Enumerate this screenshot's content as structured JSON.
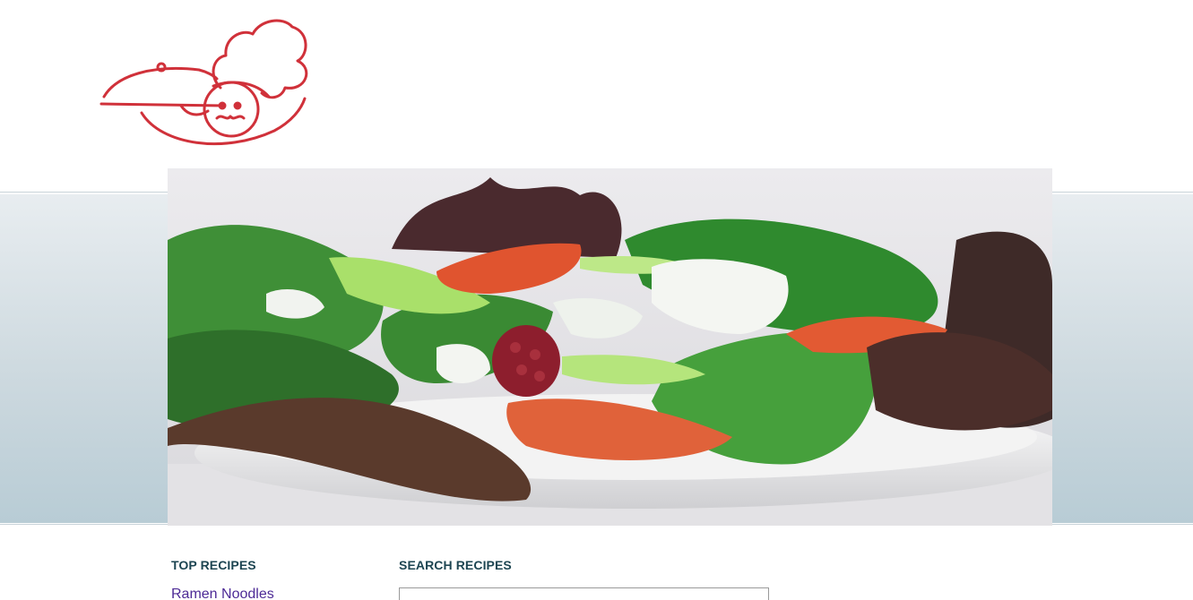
{
  "header": {
    "logo_icon": "chef-serving-cloche-logo",
    "logo_color": "#d0313a"
  },
  "hero": {
    "image_icon": "salad-plate-photo"
  },
  "top_recipes": {
    "title": "TOP RECIPES",
    "items": [
      {
        "label": "Ramen Noodles"
      }
    ]
  },
  "search": {
    "title": "SEARCH RECIPES",
    "value": ""
  },
  "colors": {
    "heading": "#1d4552",
    "link": "#4d2a96",
    "band_top": "#e8edf0",
    "band_bottom": "#b8ccd5"
  }
}
